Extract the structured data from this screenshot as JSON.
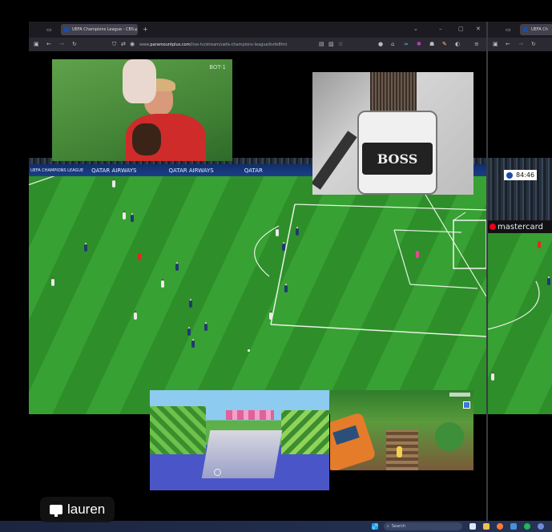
{
  "browser_main": {
    "tab_title": "UEFA Champions League - CBS",
    "new_tab": "+",
    "url_prefix": "www.",
    "url_domain": "paramountplus.com",
    "url_path": "/live-tv/stream/uefa-champions-league/bvfe8fmi",
    "window_controls": [
      "⌄",
      "–",
      "▢",
      "✕"
    ]
  },
  "browser_right": {
    "tab_title": "UEFA Ch"
  },
  "broadcast": {
    "channel_bug": "BOT-1",
    "adboards": [
      "UEFA CHAMPIONS LEAGUE",
      "QATAR AIRWAYS",
      "QATAR AIRWAYS",
      "QATAR"
    ],
    "right_clock": "84:46",
    "right_adboard": "mastercard"
  },
  "overlay_video": {
    "label": "BOSS"
  },
  "taskbar": {
    "search_placeholder": "Search"
  },
  "user_badge": {
    "name": "lauren",
    "icon": "monitor-icon"
  },
  "colors": {
    "pitch_light": "#37a133",
    "pitch_dark": "#2e8f2a",
    "adboard": "#0f2e6b",
    "browser_chrome": "#1c1b22"
  }
}
